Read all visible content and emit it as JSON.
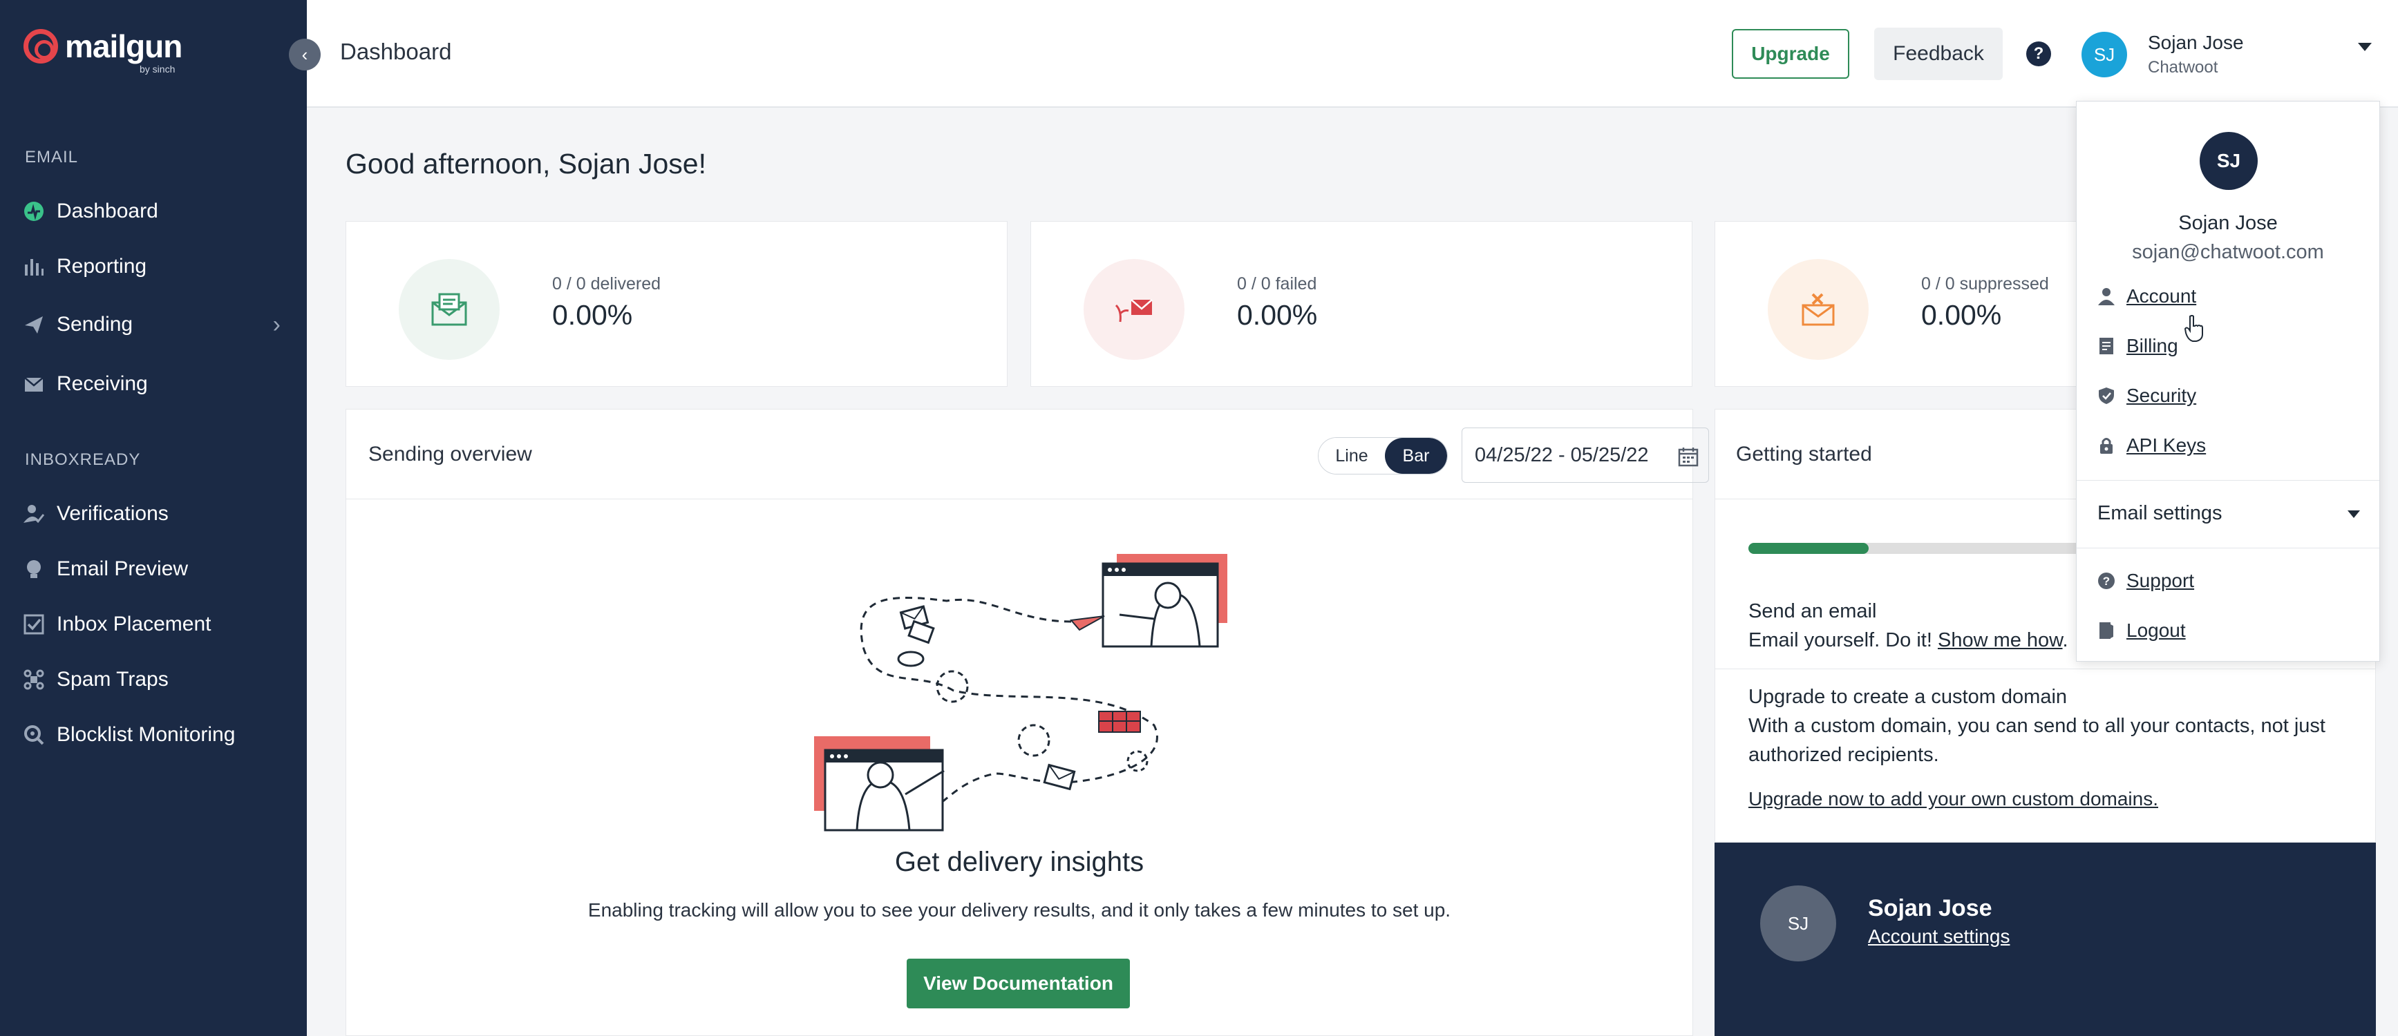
{
  "brand": {
    "name": "mailgun",
    "sub": "by sinch",
    "accent": "#e5454b"
  },
  "sidebar": {
    "sections": [
      {
        "title": "EMAIL",
        "items": [
          {
            "label": "Dashboard",
            "icon": "dashboard-icon"
          },
          {
            "label": "Reporting",
            "icon": "bar-chart-icon"
          },
          {
            "label": "Sending",
            "icon": "paper-plane-icon",
            "has_submenu": true
          },
          {
            "label": "Receiving",
            "icon": "inbox-icon"
          }
        ]
      },
      {
        "title": "INBOXREADY",
        "items": [
          {
            "label": "Verifications",
            "icon": "user-check-icon"
          },
          {
            "label": "Email Preview",
            "icon": "lightbulb-icon"
          },
          {
            "label": "Inbox Placement",
            "icon": "checkbox-icon"
          },
          {
            "label": "Spam Traps",
            "icon": "trap-icon"
          },
          {
            "label": "Blocklist Monitoring",
            "icon": "monitor-icon"
          }
        ]
      }
    ]
  },
  "header": {
    "title": "Dashboard",
    "upgrade_label": "Upgrade",
    "feedback_label": "Feedback",
    "avatar_initials": "SJ",
    "user_name": "Sojan Jose",
    "org_name": "Chatwoot"
  },
  "main": {
    "greeting": "Good afternoon, Sojan Jose!",
    "stats": [
      {
        "label": "0 / 0 delivered",
        "value": "0.00%",
        "icon": "envelope-delivered-icon",
        "color": "#3a9b6e"
      },
      {
        "label": "0 / 0 failed",
        "value": "0.00%",
        "icon": "envelope-failed-icon",
        "color": "#d9434a"
      },
      {
        "label": "0 / 0 suppressed",
        "value": "0.00%",
        "icon": "envelope-suppressed-icon",
        "color": "#f08a3c"
      }
    ],
    "sending_overview": {
      "title": "Sending overview",
      "toggle_line": "Line",
      "toggle_bar": "Bar",
      "selected": "Bar",
      "date_range": "04/25/22 - 05/25/22",
      "empty_title": "Get delivery insights",
      "empty_text": "Enabling tracking will allow you to see your delivery results, and it only takes a few minutes to set up.",
      "button_label": "View Documentation"
    },
    "getting_started": {
      "title": "Getting started",
      "progress": 0.31,
      "send_title": "Send an email",
      "send_text": "Email yourself. Do it!",
      "send_link": "Show me how",
      "send_after": ".",
      "upgrade_title": "Upgrade to create a custom domain",
      "upgrade_text": "With a custom domain, you can send to all your contacts, not just authorized recipients.",
      "upgrade_link": "Upgrade now to add your own custom domains."
    },
    "account_card": {
      "initials": "SJ",
      "name": "Sojan Jose",
      "link": "Account settings"
    }
  },
  "dropdown": {
    "initials": "SJ",
    "name": "Sojan Jose",
    "email": "sojan@chatwoot.com",
    "items": [
      {
        "label": "Account",
        "icon": "person-icon"
      },
      {
        "label": "Billing",
        "icon": "billing-icon"
      },
      {
        "label": "Security",
        "icon": "shield-icon"
      },
      {
        "label": "API Keys",
        "icon": "lock-icon"
      }
    ],
    "email_settings": "Email settings",
    "support": "Support",
    "logout": "Logout"
  }
}
